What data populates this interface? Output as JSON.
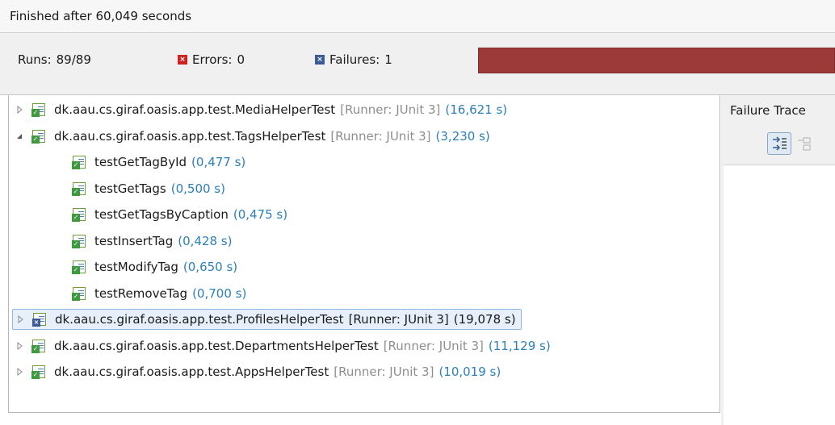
{
  "status": {
    "text": "Finished after 60,049 seconds"
  },
  "counts": {
    "runs_label": "Runs:",
    "runs_value": "89/89",
    "errors_label": "Errors:",
    "errors_value": "0",
    "failures_label": "Failures:",
    "failures_value": "1"
  },
  "progress": {
    "fraction": 1.0,
    "color": "#9c3a3a"
  },
  "failure_trace": {
    "title": "Failure Trace"
  },
  "tree": [
    {
      "name": "dk.aau.cs.giraf.oasis.app.test.MediaHelperTest",
      "runner": "[Runner: JUnit 3]",
      "time": "(16,621 s)",
      "status": "passed",
      "expanded": false,
      "level": 0
    },
    {
      "name": "dk.aau.cs.giraf.oasis.app.test.TagsHelperTest",
      "runner": "[Runner: JUnit 3]",
      "time": "(3,230 s)",
      "status": "passed",
      "expanded": true,
      "level": 0
    },
    {
      "name": "testGetTagById",
      "time": "(0,477 s)",
      "status": "passed",
      "level": 1
    },
    {
      "name": "testGetTags",
      "time": "(0,500 s)",
      "status": "passed",
      "level": 1
    },
    {
      "name": "testGetTagsByCaption",
      "time": "(0,475 s)",
      "status": "passed",
      "level": 1
    },
    {
      "name": "testInsertTag",
      "time": "(0,428 s)",
      "status": "passed",
      "level": 1
    },
    {
      "name": "testModifyTag",
      "time": "(0,650 s)",
      "status": "passed",
      "level": 1
    },
    {
      "name": "testRemoveTag",
      "time": "(0,700 s)",
      "status": "passed",
      "level": 1
    },
    {
      "name": "dk.aau.cs.giraf.oasis.app.test.ProfilesHelperTest",
      "runner": "[Runner: JUnit 3]",
      "time": "(19,078 s)",
      "status": "failed",
      "expanded": false,
      "selected": true,
      "level": 0
    },
    {
      "name": "dk.aau.cs.giraf.oasis.app.test.DepartmentsHelperTest",
      "runner": "[Runner: JUnit 3]",
      "time": "(11,129 s)",
      "status": "passed",
      "expanded": false,
      "level": 0
    },
    {
      "name": "dk.aau.cs.giraf.oasis.app.test.AppsHelperTest",
      "runner": "[Runner: JUnit 3]",
      "time": "(10,019 s)",
      "status": "passed",
      "expanded": false,
      "level": 0
    }
  ],
  "icons": {
    "expand": "triangle-right-icon",
    "collapse": "triangle-down-icon",
    "suite": "test-suite-icon",
    "test": "test-case-icon",
    "error": "error-icon",
    "failure": "failure-icon"
  },
  "colors": {
    "time": "#2c7fb8",
    "runner": "#8e8e8e",
    "pass_badge": "#3d9a3d",
    "fail_badge": "#3c5a96",
    "error_badge": "#cc2222"
  }
}
